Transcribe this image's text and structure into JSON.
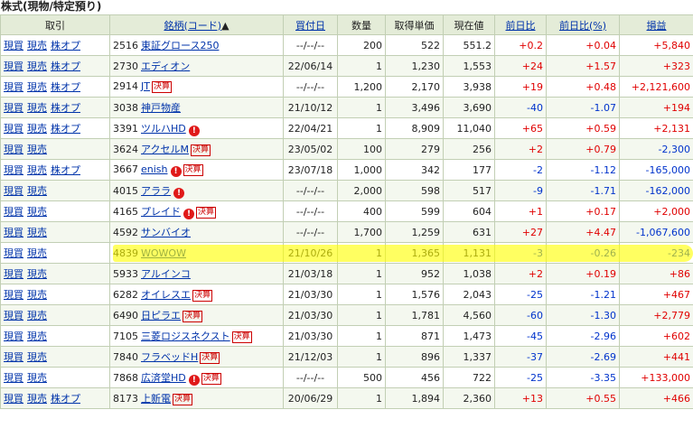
{
  "section_title": "株式(現物/特定預り)",
  "headers": {
    "action": "取引",
    "name": "銘柄(コード)",
    "sort_indicator": "▲",
    "date": "買付日",
    "qty": "数量",
    "cost": "取得単価",
    "price": "現在値",
    "change": "前日比",
    "change_pct": "前日比(%)",
    "pl": "損益"
  },
  "actions": {
    "buy": "現買",
    "sell": "現売",
    "option": "株オプ"
  },
  "badge_text": "決算",
  "alert_glyph": "!",
  "rows": [
    {
      "code": "2516",
      "name": "東証グロース250",
      "date": "--/--/--",
      "qty": "200",
      "cost": "522",
      "price": "551.2",
      "change": "+0.2",
      "change_pct": "+0.04",
      "pl": "+5,840",
      "option": true,
      "kessan": false,
      "alert": false
    },
    {
      "code": "2730",
      "name": "エディオン",
      "date": "22/06/14",
      "qty": "1",
      "cost": "1,230",
      "price": "1,553",
      "change": "+24",
      "change_pct": "+1.57",
      "pl": "+323",
      "option": true,
      "kessan": false,
      "alert": false
    },
    {
      "code": "2914",
      "name": "JT",
      "date": "--/--/--",
      "qty": "1,200",
      "cost": "2,170",
      "price": "3,938",
      "change": "+19",
      "change_pct": "+0.48",
      "pl": "+2,121,600",
      "option": true,
      "kessan": true,
      "alert": false
    },
    {
      "code": "3038",
      "name": "神戸物産",
      "date": "21/10/12",
      "qty": "1",
      "cost": "3,496",
      "price": "3,690",
      "change": "-40",
      "change_pct": "-1.07",
      "pl": "+194",
      "option": true,
      "kessan": false,
      "alert": false
    },
    {
      "code": "3391",
      "name": "ツルハHD",
      "date": "22/04/21",
      "qty": "1",
      "cost": "8,909",
      "price": "11,040",
      "change": "+65",
      "change_pct": "+0.59",
      "pl": "+2,131",
      "option": true,
      "kessan": false,
      "alert": true
    },
    {
      "code": "3624",
      "name": "アクセルM",
      "date": "23/05/02",
      "qty": "100",
      "cost": "279",
      "price": "256",
      "change": "+2",
      "change_pct": "+0.79",
      "pl": "-2,300",
      "option": false,
      "kessan": true,
      "alert": false
    },
    {
      "code": "3667",
      "name": "enish",
      "date": "23/07/18",
      "qty": "1,000",
      "cost": "342",
      "price": "177",
      "change": "-2",
      "change_pct": "-1.12",
      "pl": "-165,000",
      "option": true,
      "kessan": true,
      "alert": true
    },
    {
      "code": "4015",
      "name": "アララ",
      "date": "--/--/--",
      "qty": "2,000",
      "cost": "598",
      "price": "517",
      "change": "-9",
      "change_pct": "-1.71",
      "pl": "-162,000",
      "option": false,
      "kessan": false,
      "alert": true
    },
    {
      "code": "4165",
      "name": "プレイド",
      "date": "--/--/--",
      "qty": "400",
      "cost": "599",
      "price": "604",
      "change": "+1",
      "change_pct": "+0.17",
      "pl": "+2,000",
      "option": false,
      "kessan": true,
      "alert": true
    },
    {
      "code": "4592",
      "name": "サンバイオ",
      "date": "--/--/--",
      "qty": "1,700",
      "cost": "1,259",
      "price": "631",
      "change": "+27",
      "change_pct": "+4.47",
      "pl": "-1,067,600",
      "option": false,
      "kessan": false,
      "alert": false
    },
    {
      "code": "4839",
      "name": "WOWOW",
      "date": "21/10/26",
      "qty": "1",
      "cost": "1,365",
      "price": "1,131",
      "change": "-3",
      "change_pct": "-0.26",
      "pl": "-234",
      "option": false,
      "kessan": false,
      "alert": false
    },
    {
      "code": "5933",
      "name": "アルインコ",
      "date": "21/03/18",
      "qty": "1",
      "cost": "952",
      "price": "1,038",
      "change": "+2",
      "change_pct": "+0.19",
      "pl": "+86",
      "option": false,
      "kessan": false,
      "alert": false
    },
    {
      "code": "6282",
      "name": "オイレスエ",
      "date": "21/03/30",
      "qty": "1",
      "cost": "1,576",
      "price": "2,043",
      "change": "-25",
      "change_pct": "-1.21",
      "pl": "+467",
      "option": false,
      "kessan": true,
      "alert": false
    },
    {
      "code": "6490",
      "name": "日ピラエ",
      "date": "21/03/30",
      "qty": "1",
      "cost": "1,781",
      "price": "4,560",
      "change": "-60",
      "change_pct": "-1.30",
      "pl": "+2,779",
      "option": false,
      "kessan": true,
      "alert": false
    },
    {
      "code": "7105",
      "name": "三菱ロジスネクスト",
      "date": "21/03/30",
      "qty": "1",
      "cost": "871",
      "price": "1,473",
      "change": "-45",
      "change_pct": "-2.96",
      "pl": "+602",
      "option": false,
      "kessan": true,
      "alert": false
    },
    {
      "code": "7840",
      "name": "フラベッドH",
      "date": "21/12/03",
      "qty": "1",
      "cost": "896",
      "price": "1,337",
      "change": "-37",
      "change_pct": "-2.69",
      "pl": "+441",
      "option": false,
      "kessan": true,
      "alert": false
    },
    {
      "code": "7868",
      "name": "広済堂HD",
      "date": "--/--/--",
      "qty": "500",
      "cost": "456",
      "price": "722",
      "change": "-25",
      "change_pct": "-3.35",
      "pl": "+133,000",
      "option": false,
      "kessan": true,
      "alert": true
    },
    {
      "code": "8173",
      "name": "上新電",
      "date": "20/06/29",
      "qty": "1",
      "cost": "1,894",
      "price": "2,360",
      "change": "+13",
      "change_pct": "+0.55",
      "pl": "+466",
      "option": true,
      "kessan": true,
      "alert": false
    }
  ],
  "highlighted_row_code": "4592",
  "colors": {
    "header_bg": "#e4ecd8",
    "border": "#c2cfb4",
    "link": "#0033aa",
    "positive": "#e00000",
    "negative": "#0033cc",
    "highlight": "#ffff00"
  }
}
